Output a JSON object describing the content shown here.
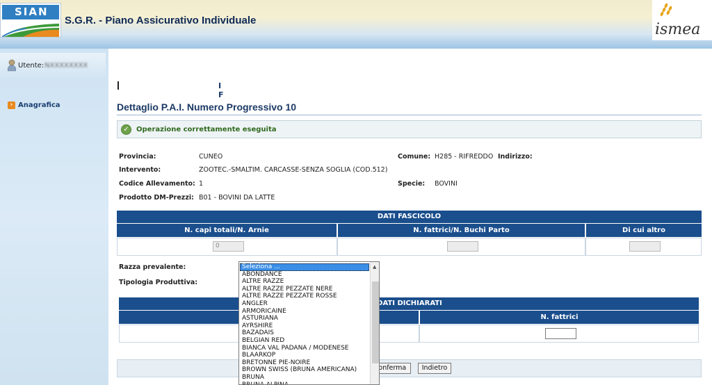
{
  "header": {
    "logo_text": "SIAN",
    "app_title": "S.G.R. - Piano Assicurativo Individuale",
    "partner_logo_text": "ismea"
  },
  "sidebar": {
    "user_label": "Utente:",
    "user_name": "NXXXXXXXX",
    "nav_items": [
      {
        "label": "Anagrafica",
        "icon": "orange-arrow-icon"
      }
    ]
  },
  "main": {
    "redacted_suffix": "I F",
    "page_title": "Dettaglio P.A.I. Numero Progressivo 10",
    "success_message": "Operazione correttamente eseguita",
    "details": {
      "provincia_label": "Provincia:",
      "provincia_value": "CUNEO",
      "comune_label": "Comune:",
      "comune_value": "H285 - RIFREDDO",
      "indirizzo_label": "Indirizzo:",
      "intervento_label": "Intervento:",
      "intervento_value": "ZOOTEC.-SMALTIM. CARCASSE-SENZA SOGLIA (COD.512)",
      "codice_label": "Codice Allevamento:",
      "codice_value": "1",
      "specie_label": "Specie:",
      "specie_value": "BOVINI",
      "prodotto_label": "Prodotto DM-Prezzi:",
      "prodotto_value": "B01 - BOVINI DA LATTE"
    },
    "fascicolo": {
      "title": "DATI FASCICOLO",
      "columns": [
        "N. capi totali/N. Arnie",
        "N. fattrici/N. Buchi Parto",
        "Di cui altro"
      ],
      "values": [
        "0",
        "",
        ""
      ]
    },
    "razza_label": "Razza prevalente:",
    "tipologia_label": "Tipologia Produttiva:",
    "dichiarati": {
      "title": "DATI DICHIARATI",
      "col_fattrici": "N. fattrici",
      "fattrici_value": ""
    },
    "buttons": {
      "conferma": "Conferma",
      "indietro": "Indietro"
    },
    "razza_dropdown": {
      "selected": "Seleziona ...",
      "options": [
        "Seleziona ...",
        "ABONDANCE",
        "ALTRE RAZZE",
        "ALTRE RAZZE PEZZATE NERE",
        "ALTRE RAZZE PEZZATE ROSSE",
        "ANGLER",
        "ARMORICAINE",
        "ASTURIANA",
        "AYRSHIRE",
        "BAZADAIS",
        "BELGIAN RED",
        "BIANCA VAL PADANA / MODENESE",
        "BLAARKOP",
        "BRETONNE PIE-NOIRE",
        "BROWN SWISS (BRUNA AMERICANA)",
        "BRUNA",
        "BRUNA ALPINA"
      ]
    }
  }
}
